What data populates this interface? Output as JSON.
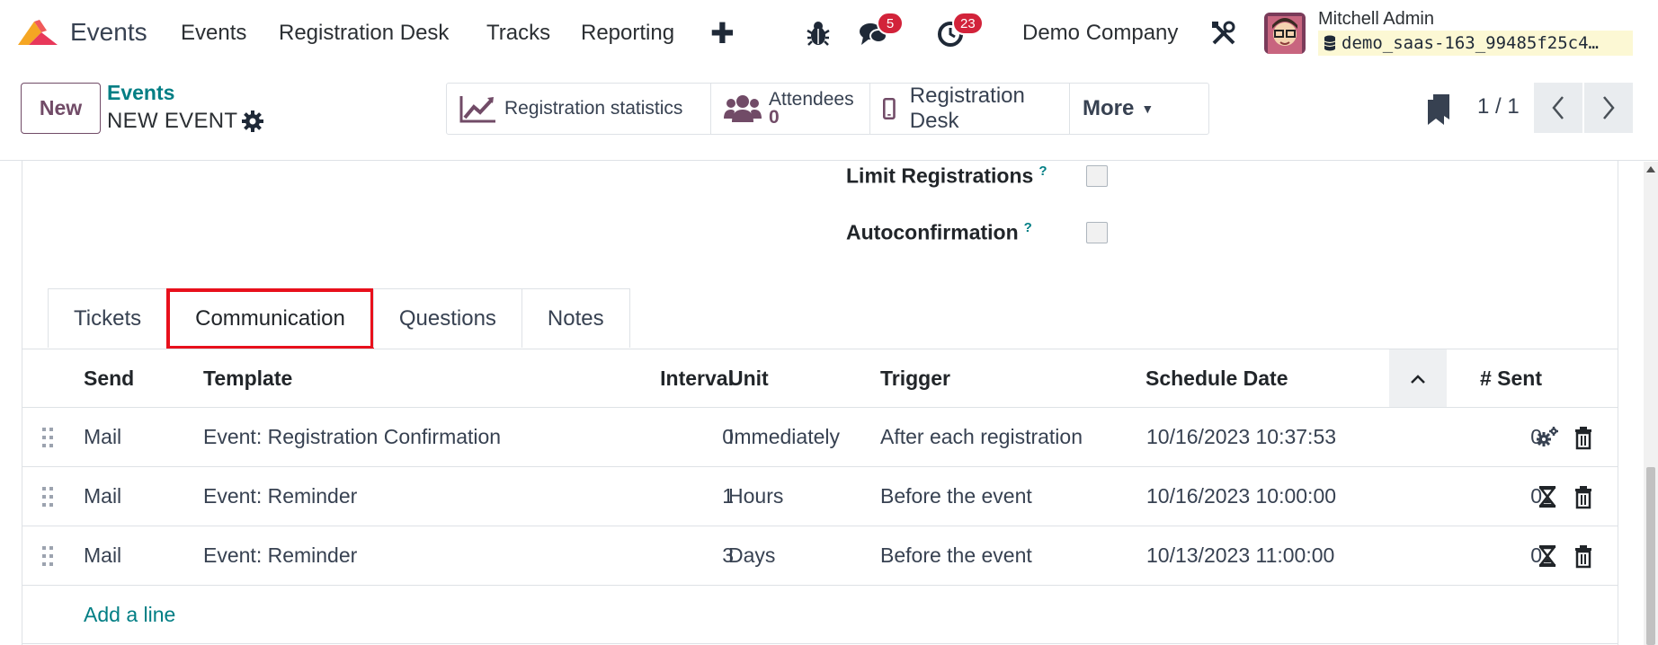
{
  "navbar": {
    "app_name": "Events",
    "menu": [
      "Events",
      "Registration Desk",
      "Tracks",
      "Reporting"
    ],
    "messages_count": "5",
    "activities_count": "23",
    "company": "Demo Company",
    "user_name": "Mitchell Admin",
    "database": "demo_saas-163_99485f25c4…"
  },
  "control": {
    "new_label": "New",
    "breadcrumb_parent": "Events",
    "record_title": "NEW EVENT",
    "smart_buttons": {
      "stats": "Registration statistics",
      "attendees_label": "Attendees",
      "attendees_count": "0",
      "desk": "Registration Desk",
      "more": "More"
    },
    "pager": "1 / 1"
  },
  "form": {
    "limit_label": "Limit Registrations",
    "autoconfirm_label": "Autoconfirmation",
    "help_mark": "?",
    "tabs": [
      "Tickets",
      "Communication",
      "Questions",
      "Notes"
    ],
    "active_tab": "Communication"
  },
  "table": {
    "headers": {
      "send": "Send",
      "template": "Template",
      "interval": "Interval",
      "unit": "Unit",
      "trigger": "Trigger",
      "schedule": "Schedule Date",
      "sent": "# Sent"
    },
    "rows": [
      {
        "send": "Mail",
        "template": "Event: Registration Confirmation",
        "interval": "0",
        "unit": "Immediately",
        "trigger": "After each registration",
        "schedule": "10/16/2023 10:37:53",
        "sent": "0",
        "status_icon": "gears-icon"
      },
      {
        "send": "Mail",
        "template": "Event: Reminder",
        "interval": "1",
        "unit": "Hours",
        "trigger": "Before the event",
        "schedule": "10/16/2023 10:00:00",
        "sent": "0",
        "status_icon": "hourglass-icon"
      },
      {
        "send": "Mail",
        "template": "Event: Reminder",
        "interval": "3",
        "unit": "Days",
        "trigger": "Before the event",
        "schedule": "10/13/2023 11:00:00",
        "sent": "0",
        "status_icon": "hourglass-icon"
      }
    ],
    "add_line": "Add a line"
  },
  "colors": {
    "brand": "#714b67",
    "link": "#017e84",
    "badge": "#d2233a",
    "highlight": "#e8101c"
  }
}
